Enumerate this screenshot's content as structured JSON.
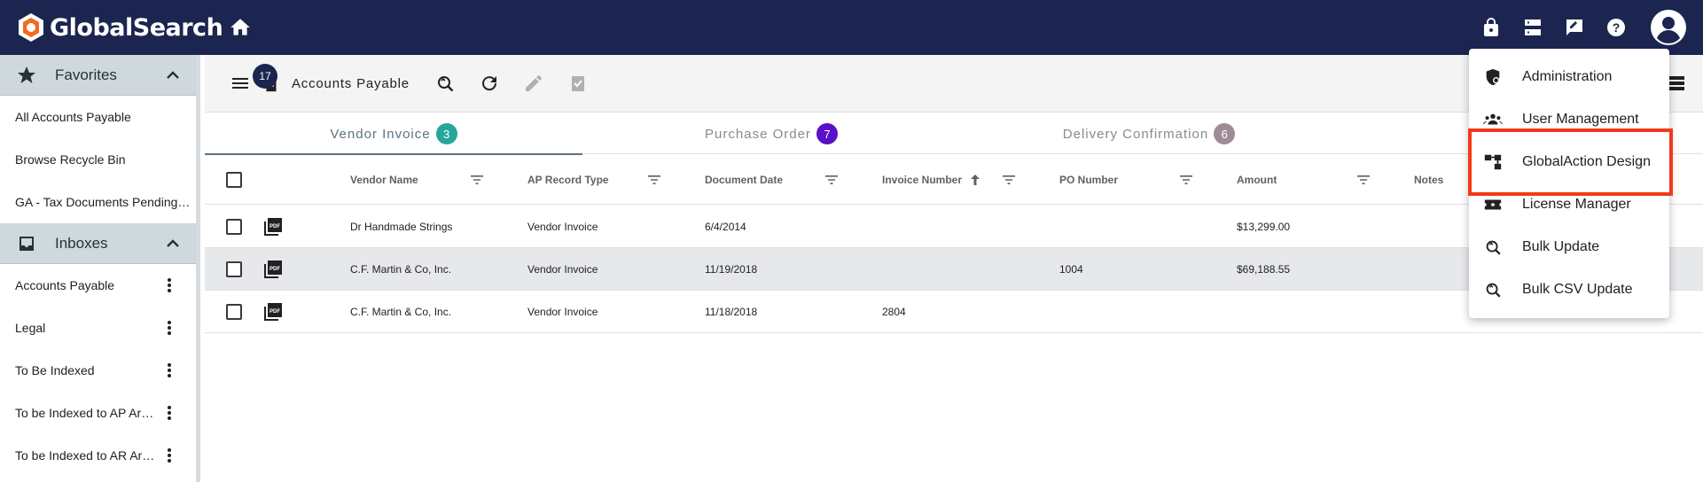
{
  "app": {
    "name": "GlobalSearch"
  },
  "colors": {
    "topbar": "#1b2550",
    "highlight": "#f03a17",
    "vendor_badge": "#26a69a",
    "po_badge": "#5a0fc8",
    "delivery_badge": "#a08a95"
  },
  "topbar": {
    "icons": [
      "home-icon",
      "lock-icon",
      "server-icon",
      "edit-note-icon",
      "help-icon",
      "account-icon"
    ]
  },
  "sidebar": {
    "favorites": {
      "title": "Favorites",
      "items": [
        {
          "label": "All Accounts Payable"
        },
        {
          "label": "Browse Recycle Bin"
        },
        {
          "label": "GA - Tax Documents Pending Approval"
        }
      ]
    },
    "inboxes": {
      "title": "Inboxes",
      "items": [
        {
          "label": "Accounts Payable"
        },
        {
          "label": "Legal"
        },
        {
          "label": "To Be Indexed"
        },
        {
          "label": "To be Indexed to AP Archive"
        },
        {
          "label": "To be Indexed to AR Archive"
        }
      ]
    }
  },
  "toolbar": {
    "count": "17",
    "title": "Accounts Payable"
  },
  "tabs": [
    {
      "label": "Vendor Invoice",
      "count": "3"
    },
    {
      "label": "Purchase Order",
      "count": "7"
    },
    {
      "label": "Delivery Confirmation",
      "count": "6"
    }
  ],
  "table": {
    "columns": [
      "Vendor Name",
      "AP Record Type",
      "Document Date",
      "Invoice Number",
      "PO Number",
      "Amount",
      "Notes"
    ],
    "rows": [
      {
        "vendor": "Dr Handmade Strings",
        "type": "Vendor Invoice",
        "date": "6/4/2014",
        "invoice": "",
        "po": "",
        "amount": "$13,299.00"
      },
      {
        "vendor": "C.F. Martin & Co, Inc.",
        "type": "Vendor Invoice",
        "date": "11/19/2018",
        "invoice": "",
        "po": "1004",
        "amount": "$69,188.55"
      },
      {
        "vendor": "C.F. Martin & Co, Inc.",
        "type": "Vendor Invoice",
        "date": "11/18/2018",
        "invoice": "2804",
        "po": "",
        "amount": ""
      }
    ]
  },
  "menu": {
    "items": [
      {
        "label": "Administration",
        "icon": "admin-shield-icon"
      },
      {
        "label": "User Management",
        "icon": "users-icon"
      },
      {
        "label": "GlobalAction Design",
        "icon": "workflow-icon"
      },
      {
        "label": "License Manager",
        "icon": "ticket-icon"
      },
      {
        "label": "Bulk Update",
        "icon": "search-refresh-icon"
      },
      {
        "label": "Bulk CSV Update",
        "icon": "search-refresh-icon"
      }
    ]
  }
}
